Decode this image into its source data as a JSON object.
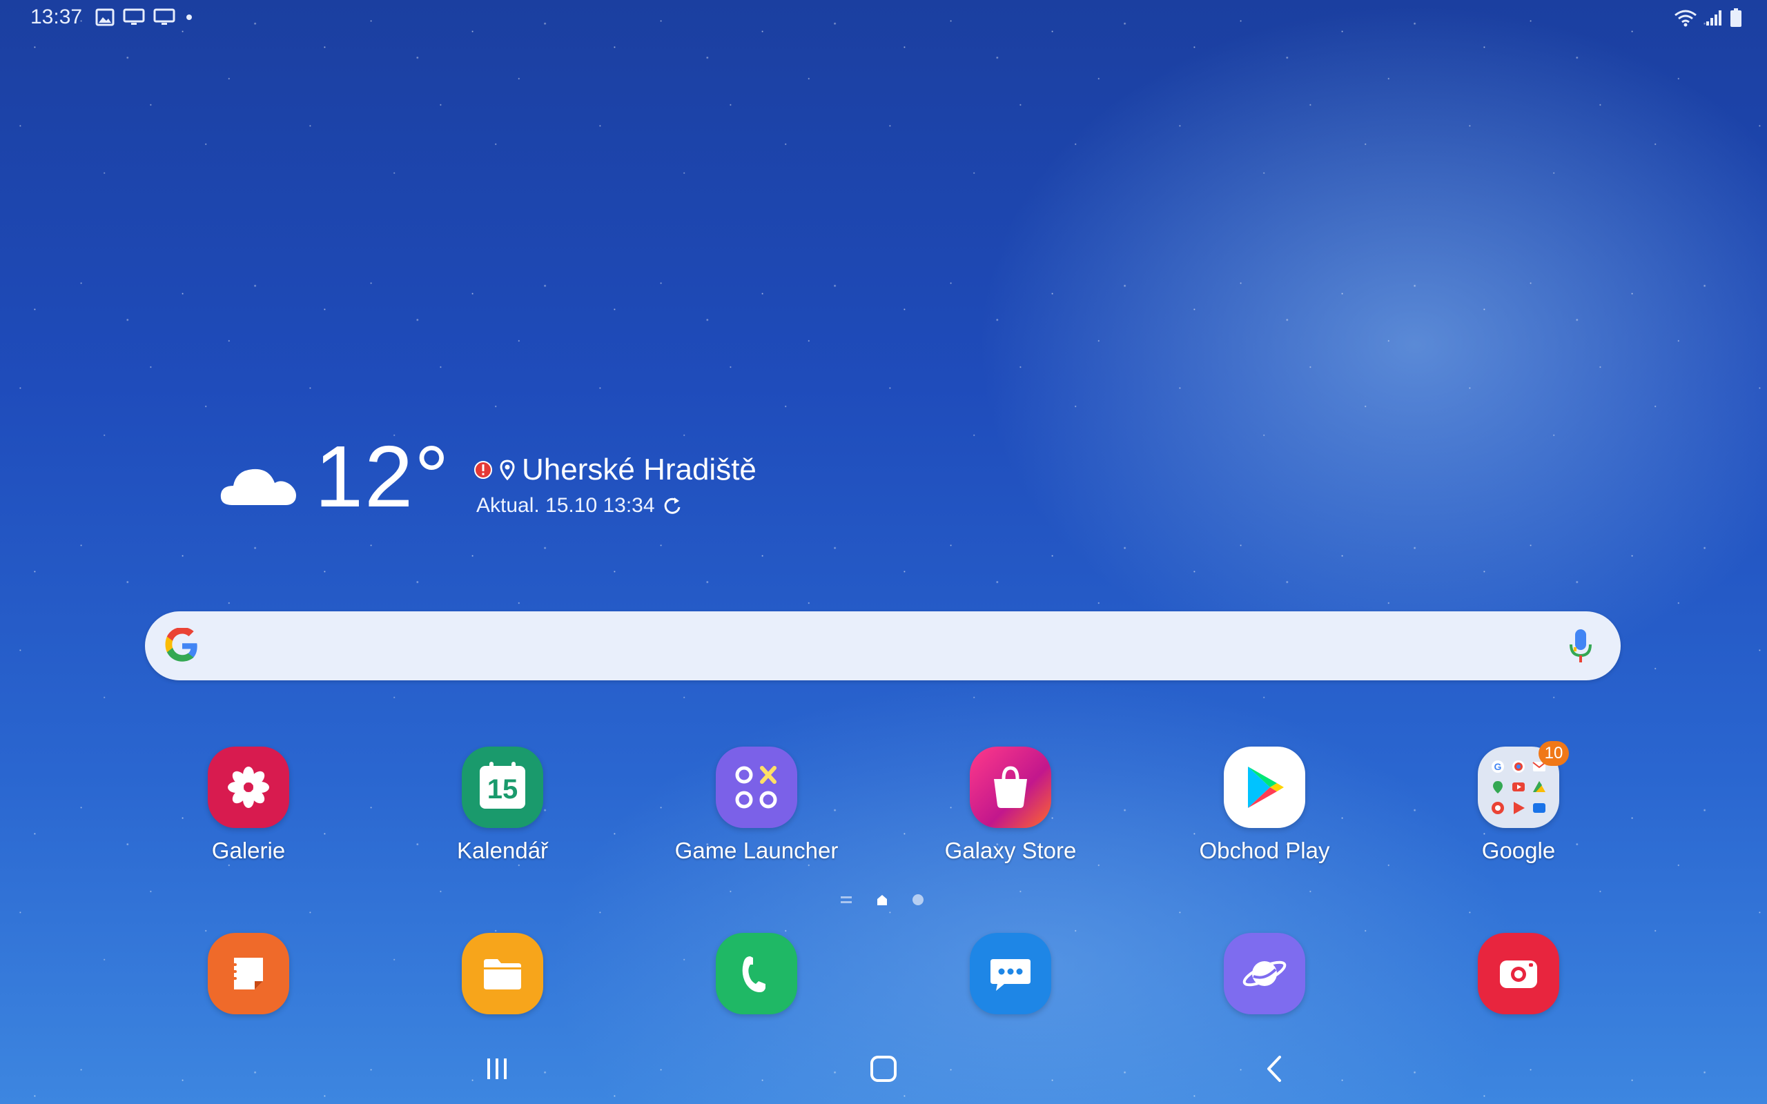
{
  "status_bar": {
    "time": "13:37",
    "left_icons": [
      "image-icon",
      "screen-icon",
      "screen-icon",
      "dot-icon"
    ],
    "right_icons": [
      "wifi-icon",
      "signal-icon",
      "battery-icon"
    ]
  },
  "weather": {
    "temperature": "12°",
    "condition_icon": "cloud-icon",
    "alert_icon": "alert-icon",
    "location_icon": "location-pin-icon",
    "city": "Uherské Hradiště",
    "updated": "Aktual. 15.10 13:34",
    "refresh_icon": "refresh-icon"
  },
  "search": {
    "logo": "google-g-icon",
    "mic_icon": "mic-icon"
  },
  "apps": [
    {
      "label": "Galerie",
      "color": "#d81b4f",
      "icon": "flower-icon"
    },
    {
      "label": "Kalendář",
      "color": "#1a9a6c",
      "icon": "calendar-icon",
      "date": "15"
    },
    {
      "label": "Game Launcher",
      "color": "#7b61e8",
      "icon": "game-launcher-icon"
    },
    {
      "label": "Galaxy Store",
      "color": "#e6187e",
      "icon": "shopping-bag-icon"
    },
    {
      "label": "Obchod Play",
      "color": "#ffffff",
      "icon": "play-store-icon"
    },
    {
      "label": "Google",
      "color": "#dfe6f3",
      "icon": "folder-icon",
      "badge": "10"
    }
  ],
  "dock": [
    {
      "name": "notes",
      "color": "#ef6a2a",
      "icon": "notes-icon"
    },
    {
      "name": "files",
      "color": "#f7a51b",
      "icon": "folder-icon"
    },
    {
      "name": "phone",
      "color": "#1fb865",
      "icon": "phone-icon"
    },
    {
      "name": "messages",
      "color": "#1e86e6",
      "icon": "chat-icon"
    },
    {
      "name": "internet",
      "color": "#7e6cef",
      "icon": "planet-icon"
    },
    {
      "name": "screen-recorder",
      "color": "#e8253e",
      "icon": "camera-icon"
    }
  ],
  "page_indicator": {
    "items": [
      "menu",
      "home",
      "page"
    ],
    "active": 1
  },
  "nav": {
    "recents": "recents-icon",
    "home": "home-icon",
    "back": "back-icon"
  }
}
